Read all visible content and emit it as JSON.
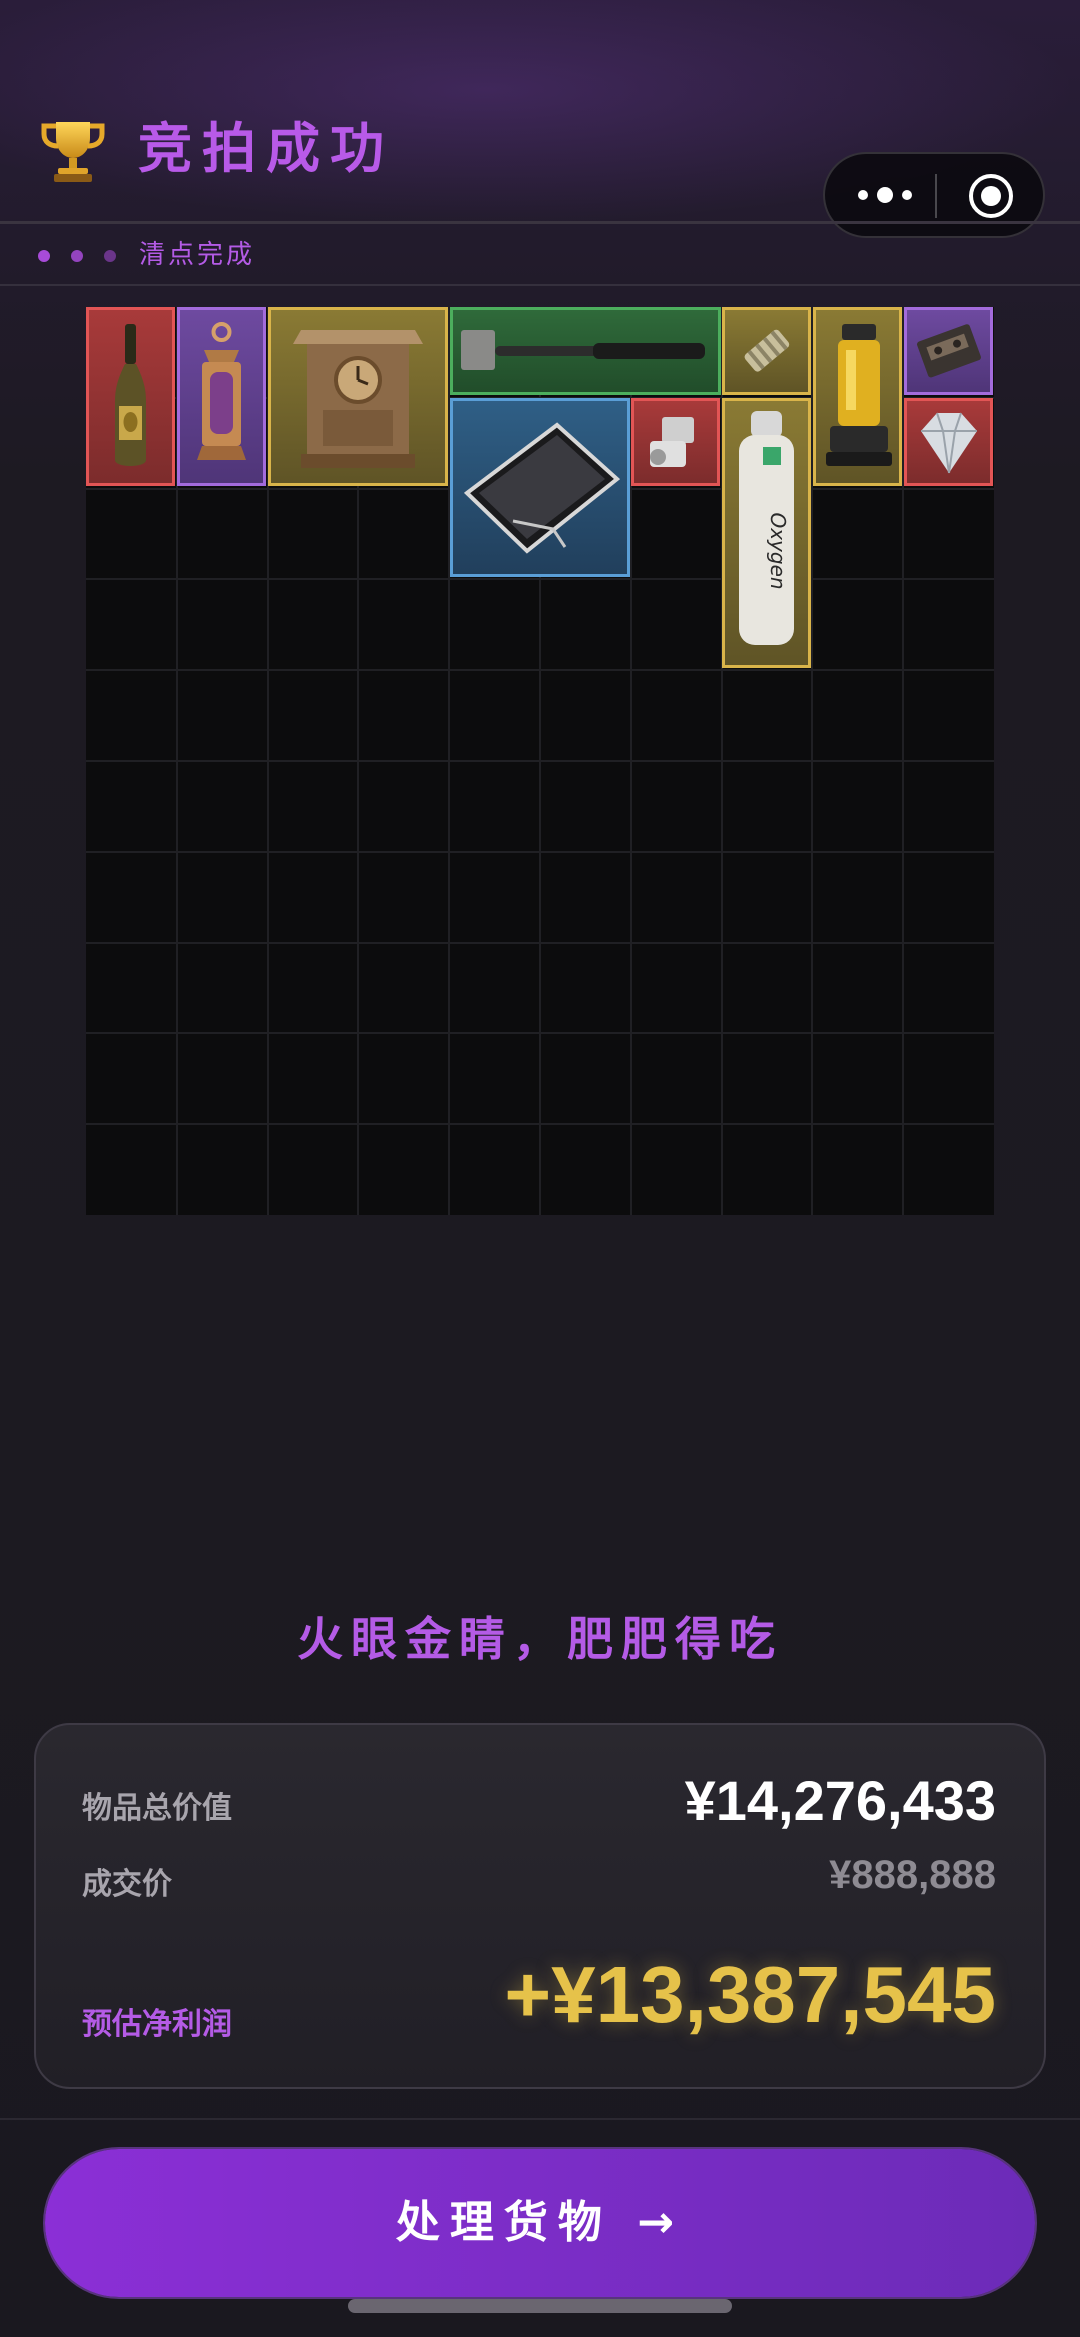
{
  "header": {
    "title": "竞拍成功",
    "trophy_icon": "trophy-icon",
    "status_text": "清点完成",
    "more_icon": "more-dots-icon",
    "close_icon": "target-circle-icon"
  },
  "colors": {
    "accent": "#b45be6",
    "profit": "#e6c24a",
    "rarity_red": "#e25555",
    "rarity_purple": "#a36bdc",
    "rarity_gold": "#d9b44a",
    "rarity_green": "#4cae5d",
    "rarity_blue": "#5a9ed6"
  },
  "inventory": {
    "items": [
      {
        "name": "champagne-bottle",
        "rarity": "red"
      },
      {
        "name": "ornate-lantern",
        "rarity": "purple"
      },
      {
        "name": "antique-clock",
        "rarity": "gold"
      },
      {
        "name": "sledgehammer",
        "rarity": "green"
      },
      {
        "name": "tablet",
        "rarity": "blue"
      },
      {
        "name": "metal-coil",
        "rarity": "gold"
      },
      {
        "name": "yellow-device",
        "rarity": "gold"
      },
      {
        "name": "cassette-tape",
        "rarity": "purple"
      },
      {
        "name": "electronic-part",
        "rarity": "red"
      },
      {
        "name": "oxygen-tank",
        "rarity": "gold"
      },
      {
        "name": "diamond",
        "rarity": "red"
      }
    ]
  },
  "slogan": "火眼金睛，肥肥得吃",
  "summary": {
    "total_label": "物品总价值",
    "total_value": "¥14,276,433",
    "deal_label": "成交价",
    "deal_value": "¥888,888",
    "profit_label": "预估净利润",
    "profit_value": "+¥13,387,545"
  },
  "cta": {
    "label": "处理货物 →"
  }
}
